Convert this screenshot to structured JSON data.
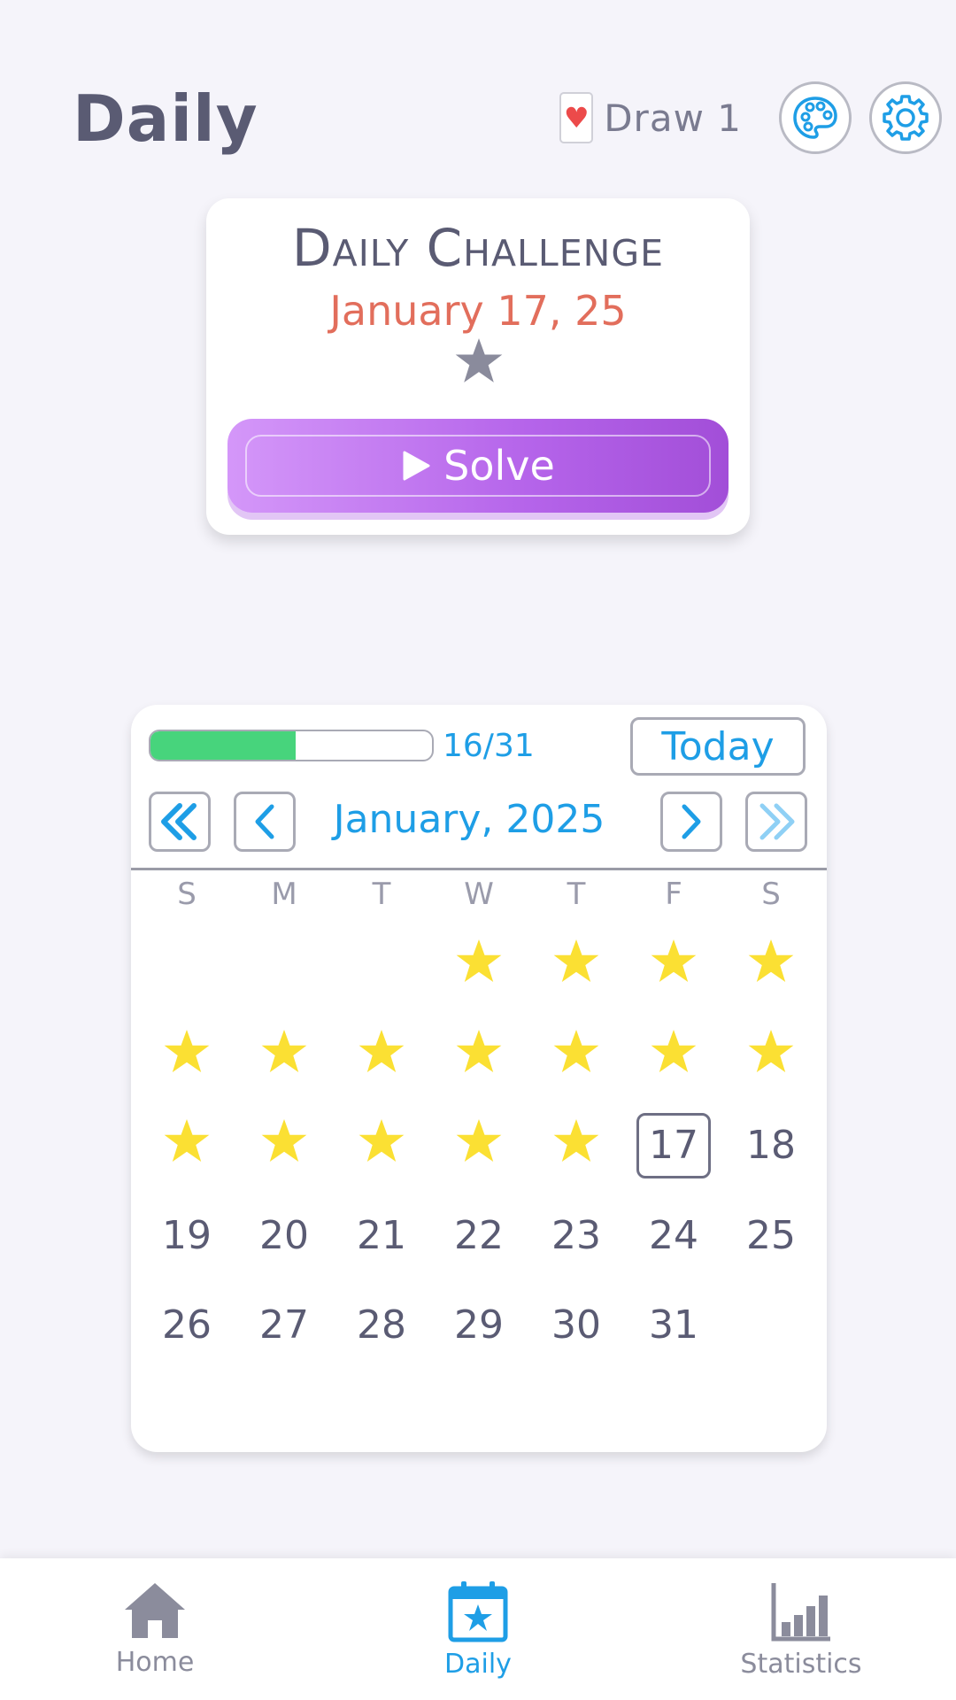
{
  "header": {
    "title": "Daily",
    "draw_label": "Draw 1",
    "card_suit": "♥"
  },
  "challenge": {
    "title": "Daily Challenge",
    "date": "January 17, 25",
    "solve_label": "Solve"
  },
  "calendar": {
    "progress_label": "16/31",
    "progress_fraction": 0.516,
    "today_label": "Today",
    "month_label": "January, 2025",
    "weekdays": [
      "S",
      "M",
      "T",
      "W",
      "T",
      "F",
      "S"
    ],
    "first_weekday_index": 3,
    "days_in_month": 31,
    "completed_days": [
      1,
      2,
      3,
      4,
      5,
      6,
      7,
      8,
      9,
      10,
      11,
      12,
      13,
      14,
      15,
      16
    ],
    "today": 17
  },
  "nav": {
    "home": "Home",
    "daily": "Daily",
    "statistics": "Statistics"
  },
  "colors": {
    "accent": "#1e9ee6",
    "progress": "#47d47c",
    "star_gold": "#fbe033",
    "solve_gradient": [
      "#d497f9",
      "#a24ed8"
    ],
    "date_red": "#e26e5c"
  }
}
